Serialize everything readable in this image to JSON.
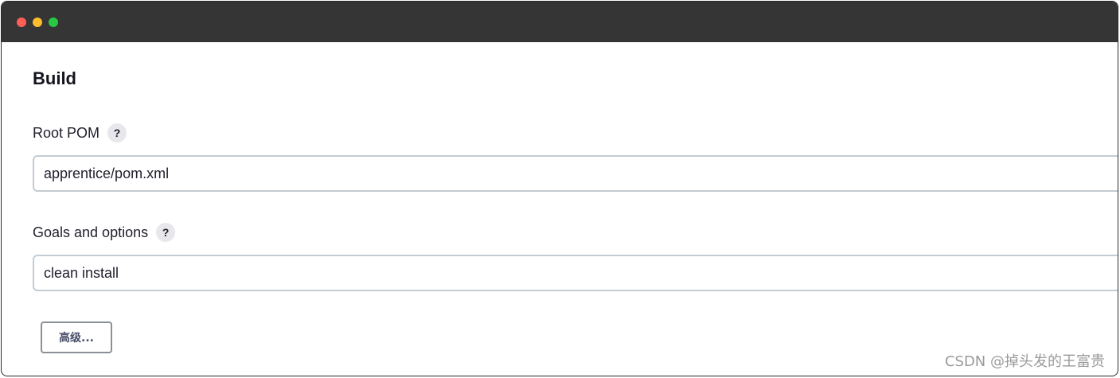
{
  "window": {
    "traffic_lights": {
      "close_color": "#ff5f57",
      "minimize_color": "#febc2e",
      "maximize_color": "#28c840"
    }
  },
  "section": {
    "title": "Build"
  },
  "root_pom": {
    "label": "Root POM",
    "help": "?",
    "value": "apprentice/pom.xml"
  },
  "goals": {
    "label": "Goals and options",
    "help": "?",
    "value": "clean install"
  },
  "advanced_button": {
    "label": "高级..."
  },
  "watermark": {
    "text": "CSDN @掉头发的王富贵"
  }
}
